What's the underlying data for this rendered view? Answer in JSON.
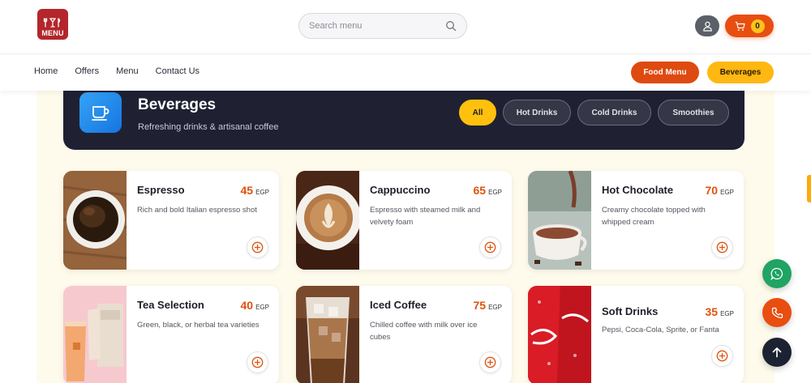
{
  "brand": {
    "logo_text": "MENU",
    "logo_icon": "restaurant-icon"
  },
  "search": {
    "placeholder": "Search menu",
    "value": ""
  },
  "cart": {
    "count": "0"
  },
  "nav": {
    "links": [
      "Home",
      "Offers",
      "Menu",
      "Contact Us"
    ]
  },
  "menu_switch": {
    "food_label": "Food Menu",
    "beverages_label": "Beverages"
  },
  "category": {
    "title": "Beverages",
    "subtitle": "Refreshing drinks & artisanal coffee",
    "icon": "coffee-cup-icon",
    "filters": [
      "All",
      "Hot Drinks",
      "Cold Drinks",
      "Smoothies"
    ],
    "active_filter": "All"
  },
  "products": [
    {
      "name": "Espresso",
      "price": "45",
      "currency": "EGP",
      "description": "Rich and bold Italian espresso shot"
    },
    {
      "name": "Cappuccino",
      "price": "65",
      "currency": "EGP",
      "description": "Espresso with steamed milk and velvety foam"
    },
    {
      "name": "Hot Chocolate",
      "price": "70",
      "currency": "EGP",
      "description": "Creamy chocolate topped with whipped cream"
    },
    {
      "name": "Tea Selection",
      "price": "40",
      "currency": "EGP",
      "description": "Green, black, or herbal tea varieties"
    },
    {
      "name": "Iced Coffee",
      "price": "75",
      "currency": "EGP",
      "description": "Chilled coffee with milk over ice cubes"
    },
    {
      "name": "Soft Drinks",
      "price": "35",
      "currency": "EGP",
      "description": "Pepsi, Coca-Cola, Sprite, or Fanta"
    }
  ],
  "colors": {
    "accent_orange": "#e84e0f",
    "accent_yellow": "#ffc10d",
    "banner_dark": "#1f2133",
    "whatsapp_green": "#1fa463"
  }
}
